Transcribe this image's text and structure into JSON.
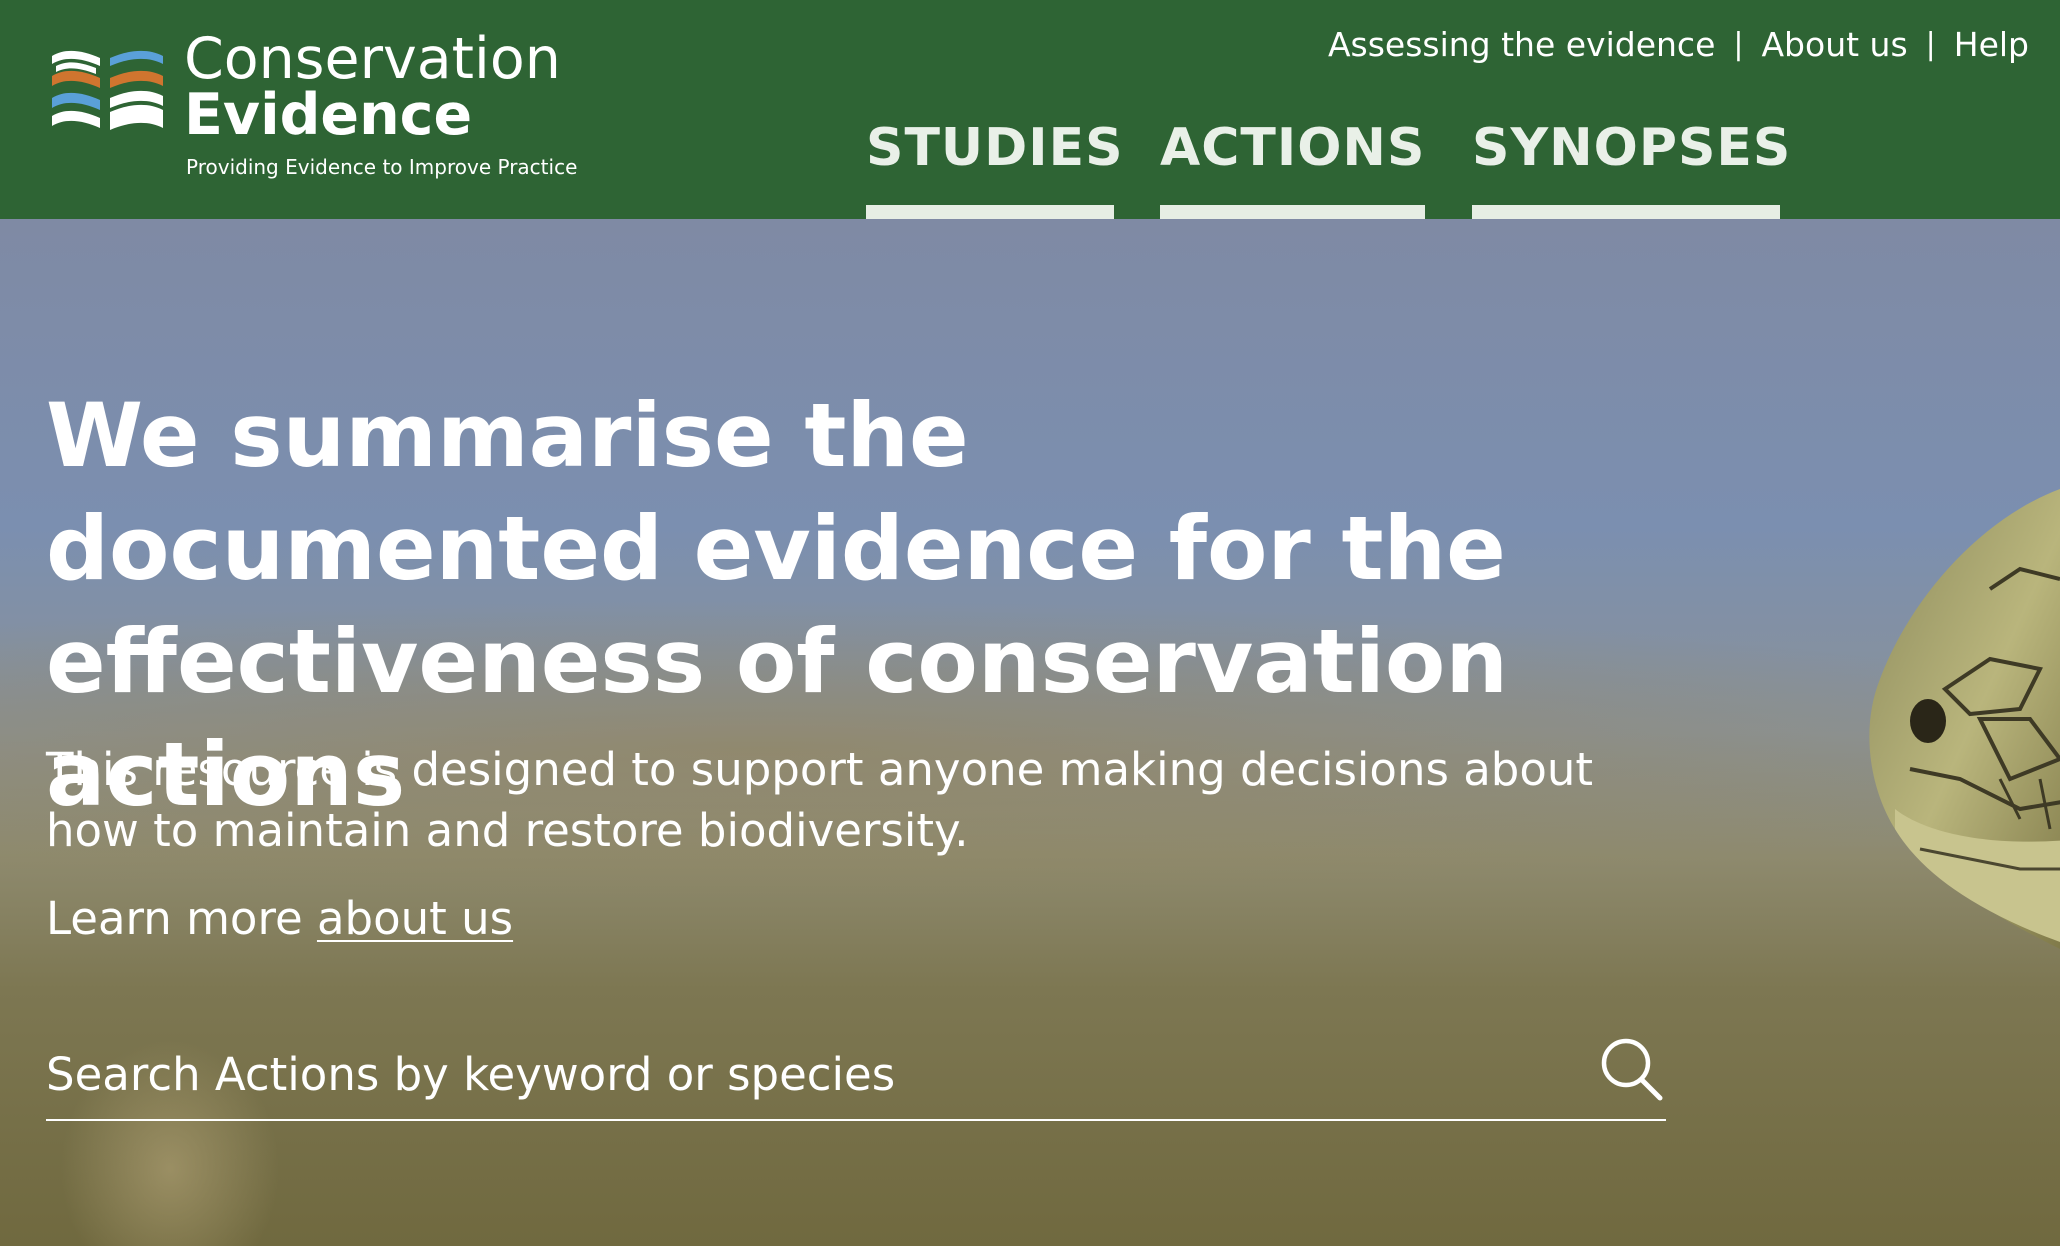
{
  "logo": {
    "title_line1": "Conservation",
    "title_line2": "Evidence",
    "tagline": "Providing Evidence to Improve Practice",
    "colors": {
      "blue": "#5aa0d8",
      "orange": "#d0752f",
      "white": "#ffffff"
    }
  },
  "utility_nav": {
    "items": [
      {
        "label": "Assessing the evidence"
      },
      {
        "label": "About us"
      },
      {
        "label": "Help"
      }
    ],
    "separator": "|"
  },
  "main_nav": {
    "tabs": [
      {
        "label": "STUDIES"
      },
      {
        "label": "ACTIONS"
      },
      {
        "label": "SYNOPSES"
      }
    ]
  },
  "hero": {
    "headline": "We summarise the documented evidence for the effectiveness of conservation actions",
    "subtext": "This resource is designed to support anyone making decisions about how to maintain and restore biodiversity.",
    "learn_more_prefix": "Learn more ",
    "learn_more_link": "about us"
  },
  "search": {
    "placeholder": "Search Actions by keyword or species",
    "value": "",
    "icon": "search-icon"
  },
  "colors": {
    "header_bg": "#2e6434",
    "nav_underline": "#e6eee4",
    "text": "#ffffff"
  }
}
